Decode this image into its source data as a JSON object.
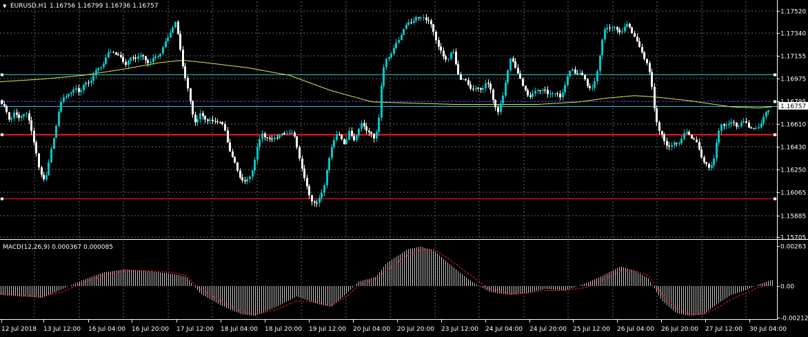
{
  "header": {
    "arrow": "▼",
    "symbol": "EURUSD,H1",
    "ohlc": "1.16756 1.16799 1.16736 1.16757"
  },
  "macd": {
    "title": "MACD(12,26,9) 0.000367 0.000085",
    "axis_labels": [
      "0.00263",
      "0.00",
      "-0.002127"
    ]
  },
  "colors": {
    "background": "#000000",
    "bull": "#00c8c8",
    "bear": "#ffffff",
    "ma": "#e8e84a",
    "red_line": "#ff1a1a",
    "blue_dashed": "#2828ff",
    "teal_line": "#28c8c8",
    "macd_signal": "#ff2020",
    "grid": "#6a6a6a"
  },
  "chart_data": [
    {
      "type": "candlestick",
      "symbol": "EURUSD,H1",
      "y_ticks": [
        "1.17520",
        "1.17340",
        "1.17155",
        "1.16975",
        "1.16795",
        "1.16610",
        "1.16430",
        "1.16250",
        "1.16065",
        "1.15885",
        "1.15705"
      ],
      "ylim": [
        1.15705,
        1.1762
      ],
      "x_ticks": [
        "12 Jul 2018",
        "13 Jul 12:00",
        "16 Jul 04:00",
        "16 Jul 20:00",
        "17 Jul 12:00",
        "18 Jul 04:00",
        "18 Jul 20:00",
        "19 Jul 12:00",
        "20 Jul 04:00",
        "20 Jul 20:00",
        "23 Jul 12:00",
        "24 Jul 04:00",
        "24 Jul 20:00",
        "25 Jul 12:00",
        "26 Jul 04:00",
        "26 Jul 20:00",
        "27 Jul 12:00",
        "30 Jul 04:00"
      ],
      "current_price": "1.16757",
      "horizontal_levels": [
        {
          "kind": "teal-solid",
          "price": 1.1701
        },
        {
          "kind": "blue-dashed",
          "price": 1.16795
        },
        {
          "kind": "teal-thin",
          "price": 1.16757
        },
        {
          "kind": "red-solid",
          "price": 1.1653
        },
        {
          "kind": "red-solid",
          "price": 1.1602
        }
      ],
      "close_path": [
        [
          0,
          1.1678
        ],
        [
          8,
          1.1672
        ],
        [
          14,
          1.1665
        ],
        [
          20,
          1.1669
        ],
        [
          26,
          1.1666
        ],
        [
          32,
          1.167
        ],
        [
          38,
          1.1668
        ],
        [
          44,
          1.166
        ],
        [
          50,
          1.1645
        ],
        [
          56,
          1.1625
        ],
        [
          62,
          1.1618
        ],
        [
          68,
          1.1622
        ],
        [
          74,
          1.164
        ],
        [
          80,
          1.1658
        ],
        [
          86,
          1.1674
        ],
        [
          92,
          1.1682
        ],
        [
          98,
          1.1687
        ],
        [
          104,
          1.1685
        ],
        [
          110,
          1.169
        ],
        [
          116,
          1.1688
        ],
        [
          122,
          1.1692
        ],
        [
          128,
          1.1695
        ],
        [
          134,
          1.1699
        ],
        [
          140,
          1.1703
        ],
        [
          146,
          1.1708
        ],
        [
          152,
          1.1712
        ],
        [
          158,
          1.1718
        ],
        [
          164,
          1.172
        ],
        [
          170,
          1.1715
        ],
        [
          176,
          1.1713
        ],
        [
          182,
          1.171
        ],
        [
          188,
          1.1712
        ],
        [
          194,
          1.1714
        ],
        [
          200,
          1.1716
        ],
        [
          206,
          1.1714
        ],
        [
          212,
          1.1712
        ],
        [
          218,
          1.1711
        ],
        [
          224,
          1.1713
        ],
        [
          230,
          1.1717
        ],
        [
          236,
          1.1722
        ],
        [
          242,
          1.1728
        ],
        [
          248,
          1.1738
        ],
        [
          254,
          1.1742
        ],
        [
          260,
          1.1725
        ],
        [
          266,
          1.1705
        ],
        [
          272,
          1.1688
        ],
        [
          278,
          1.1672
        ],
        [
          284,
          1.1662
        ],
        [
          290,
          1.1668
        ],
        [
          296,
          1.1667
        ],
        [
          302,
          1.1664
        ],
        [
          308,
          1.1662
        ],
        [
          314,
          1.1665
        ],
        [
          320,
          1.1662
        ],
        [
          326,
          1.1655
        ],
        [
          332,
          1.1643
        ],
        [
          338,
          1.1632
        ],
        [
          344,
          1.1624
        ],
        [
          350,
          1.1618
        ],
        [
          356,
          1.1613
        ],
        [
          362,
          1.162
        ],
        [
          368,
          1.163
        ],
        [
          374,
          1.1644
        ],
        [
          380,
          1.1655
        ],
        [
          386,
          1.165
        ],
        [
          392,
          1.1647
        ],
        [
          398,
          1.1652
        ],
        [
          404,
          1.165
        ],
        [
          410,
          1.1653
        ],
        [
          416,
          1.1655
        ],
        [
          422,
          1.1653
        ],
        [
          428,
          1.165
        ],
        [
          434,
          1.1635
        ],
        [
          440,
          1.1618
        ],
        [
          446,
          1.161
        ],
        [
          452,
          1.16
        ],
        [
          458,
          1.1595
        ],
        [
          464,
          1.1605
        ],
        [
          470,
          1.1612
        ],
        [
          476,
          1.163
        ],
        [
          482,
          1.1648
        ],
        [
          488,
          1.1652
        ],
        [
          494,
          1.165
        ],
        [
          500,
          1.1646
        ],
        [
          506,
          1.1654
        ],
        [
          512,
          1.1648
        ],
        [
          518,
          1.1655
        ],
        [
          524,
          1.166
        ],
        [
          530,
          1.1658
        ],
        [
          536,
          1.1655
        ],
        [
          542,
          1.1648
        ],
        [
          548,
          1.166
        ],
        [
          554,
          1.17
        ],
        [
          560,
          1.1712
        ],
        [
          566,
          1.1718
        ],
        [
          572,
          1.1722
        ],
        [
          578,
          1.1728
        ],
        [
          584,
          1.1738
        ],
        [
          590,
          1.174
        ],
        [
          596,
          1.1743
        ],
        [
          602,
          1.1748
        ],
        [
          608,
          1.1744
        ],
        [
          614,
          1.1748
        ],
        [
          620,
          1.1745
        ],
        [
          626,
          1.1738
        ],
        [
          632,
          1.173
        ],
        [
          638,
          1.172
        ],
        [
          644,
          1.1712
        ],
        [
          650,
          1.1715
        ],
        [
          656,
          1.172
        ],
        [
          662,
          1.1705
        ],
        [
          668,
          1.1698
        ],
        [
          674,
          1.1695
        ],
        [
          680,
          1.1692
        ],
        [
          686,
          1.169
        ],
        [
          692,
          1.1688
        ],
        [
          698,
          1.169
        ],
        [
          704,
          1.1694
        ],
        [
          710,
          1.169
        ],
        [
          716,
          1.168
        ],
        [
          722,
          1.167
        ],
        [
          728,
          1.168
        ],
        [
          734,
          1.17
        ],
        [
          740,
          1.1712
        ],
        [
          746,
          1.1708
        ],
        [
          752,
          1.1702
        ],
        [
          758,
          1.169
        ],
        [
          764,
          1.1686
        ],
        [
          770,
          1.1684
        ],
        [
          776,
          1.1686
        ],
        [
          782,
          1.169
        ],
        [
          788,
          1.1689
        ],
        [
          794,
          1.1684
        ],
        [
          800,
          1.1688
        ],
        [
          806,
          1.1685
        ],
        [
          812,
          1.1682
        ],
        [
          818,
          1.1692
        ],
        [
          824,
          1.17
        ],
        [
          830,
          1.1705
        ],
        [
          836,
          1.1702
        ],
        [
          842,
          1.17
        ],
        [
          848,
          1.1698
        ],
        [
          854,
          1.169
        ],
        [
          860,
          1.1688
        ],
        [
          866,
          1.1705
        ],
        [
          872,
          1.1725
        ],
        [
          878,
          1.1738
        ],
        [
          884,
          1.174
        ],
        [
          890,
          1.1738
        ],
        [
          896,
          1.1735
        ],
        [
          902,
          1.1737
        ],
        [
          908,
          1.174
        ],
        [
          914,
          1.1738
        ],
        [
          920,
          1.1732
        ],
        [
          926,
          1.1722
        ],
        [
          932,
          1.1718
        ],
        [
          938,
          1.171
        ],
        [
          944,
          1.1695
        ],
        [
          950,
          1.167
        ],
        [
          956,
          1.1655
        ],
        [
          962,
          1.1648
        ],
        [
          968,
          1.1645
        ],
        [
          974,
          1.1643
        ],
        [
          980,
          1.1646
        ],
        [
          986,
          1.1648
        ],
        [
          992,
          1.1652
        ],
        [
          998,
          1.1655
        ],
        [
          1004,
          1.165
        ],
        [
          1010,
          1.1645
        ],
        [
          1016,
          1.1638
        ],
        [
          1022,
          1.163
        ],
        [
          1028,
          1.1625
        ],
        [
          1034,
          1.1632
        ],
        [
          1040,
          1.165
        ],
        [
          1046,
          1.166
        ],
        [
          1052,
          1.1662
        ],
        [
          1058,
          1.166
        ],
        [
          1064,
          1.1662
        ],
        [
          1070,
          1.166
        ],
        [
          1076,
          1.1661
        ],
        [
          1082,
          1.1663
        ],
        [
          1088,
          1.1658
        ],
        [
          1094,
          1.1655
        ],
        [
          1100,
          1.166
        ],
        [
          1106,
          1.1665
        ],
        [
          1112,
          1.167
        ],
        [
          1118,
          1.1676
        ]
      ],
      "ma_path": [
        [
          0,
          1.1695
        ],
        [
          60,
          1.1697
        ],
        [
          120,
          1.17
        ],
        [
          180,
          1.1705
        ],
        [
          230,
          1.171
        ],
        [
          265,
          1.1712
        ],
        [
          300,
          1.171
        ],
        [
          360,
          1.1706
        ],
        [
          420,
          1.17
        ],
        [
          480,
          1.1688
        ],
        [
          540,
          1.1679
        ],
        [
          600,
          1.1678
        ],
        [
          660,
          1.1677
        ],
        [
          720,
          1.1677
        ],
        [
          780,
          1.1677
        ],
        [
          840,
          1.1679
        ],
        [
          880,
          1.1682
        ],
        [
          920,
          1.1684
        ],
        [
          950,
          1.1683
        ],
        [
          1000,
          1.168
        ],
        [
          1060,
          1.1675
        ],
        [
          1100,
          1.1674
        ],
        [
          1120,
          1.1675
        ]
      ]
    },
    {
      "type": "bar",
      "title": "MACD(12,26,9) 0.000367 0.000085",
      "ylim": [
        -0.002127,
        0.00263
      ],
      "main_path": [
        [
          0,
          -0.0006
        ],
        [
          30,
          -0.0007
        ],
        [
          60,
          -0.0008
        ],
        [
          90,
          -0.0002
        ],
        [
          120,
          0.0004
        ],
        [
          150,
          0.0009
        ],
        [
          180,
          0.0011
        ],
        [
          210,
          0.001
        ],
        [
          250,
          0.0008
        ],
        [
          270,
          0.0006
        ],
        [
          290,
          -0.0005
        ],
        [
          320,
          -0.0013
        ],
        [
          350,
          -0.0019
        ],
        [
          370,
          -0.002
        ],
        [
          400,
          -0.0014
        ],
        [
          430,
          -0.0007
        ],
        [
          460,
          -0.0012
        ],
        [
          480,
          -0.0014
        ],
        [
          500,
          -0.0006
        ],
        [
          520,
          0.0003
        ],
        [
          545,
          0.0006
        ],
        [
          560,
          0.0015
        ],
        [
          590,
          0.0024
        ],
        [
          610,
          0.0026
        ],
        [
          630,
          0.0023
        ],
        [
          650,
          0.0015
        ],
        [
          680,
          0.0004
        ],
        [
          710,
          -0.0004
        ],
        [
          740,
          -0.0006
        ],
        [
          760,
          -0.0005
        ],
        [
          790,
          -0.0002
        ],
        [
          820,
          -0.0003
        ],
        [
          850,
          0.0002
        ],
        [
          870,
          0.0006
        ],
        [
          900,
          0.0013
        ],
        [
          920,
          0.001
        ],
        [
          940,
          0.0005
        ],
        [
          960,
          -0.001
        ],
        [
          980,
          -0.0018
        ],
        [
          1000,
          -0.002
        ],
        [
          1020,
          -0.0019
        ],
        [
          1040,
          -0.0012
        ],
        [
          1060,
          -0.0006
        ],
        [
          1080,
          -0.0003
        ],
        [
          1100,
          0.0001
        ],
        [
          1118,
          0.0004
        ]
      ],
      "signal_path": [
        [
          0,
          -0.0005
        ],
        [
          30,
          -0.0006
        ],
        [
          60,
          -0.0007
        ],
        [
          90,
          -0.0004
        ],
        [
          120,
          0.0002
        ],
        [
          150,
          0.0007
        ],
        [
          180,
          0.001
        ],
        [
          210,
          0.001
        ],
        [
          250,
          0.0009
        ],
        [
          270,
          0.0007
        ],
        [
          290,
          -0.0002
        ],
        [
          320,
          -0.001
        ],
        [
          350,
          -0.0017
        ],
        [
          370,
          -0.0019
        ],
        [
          400,
          -0.0016
        ],
        [
          430,
          -0.001
        ],
        [
          460,
          -0.0011
        ],
        [
          480,
          -0.0013
        ],
        [
          500,
          -0.0008
        ],
        [
          520,
          0.0
        ],
        [
          545,
          0.0005
        ],
        [
          560,
          0.001
        ],
        [
          590,
          0.002
        ],
        [
          610,
          0.0024
        ],
        [
          630,
          0.0024
        ],
        [
          650,
          0.0018
        ],
        [
          680,
          0.0008
        ],
        [
          710,
          -0.0002
        ],
        [
          740,
          -0.0005
        ],
        [
          760,
          -0.0005
        ],
        [
          790,
          -0.0003
        ],
        [
          820,
          -0.0003
        ],
        [
          850,
          -0.0001
        ],
        [
          870,
          0.0003
        ],
        [
          900,
          0.001
        ],
        [
          920,
          0.001
        ],
        [
          940,
          0.0007
        ],
        [
          960,
          -0.0005
        ],
        [
          980,
          -0.0015
        ],
        [
          1000,
          -0.0019
        ],
        [
          1020,
          -0.0019
        ],
        [
          1040,
          -0.0015
        ],
        [
          1060,
          -0.0009
        ],
        [
          1080,
          -0.0005
        ],
        [
          1100,
          -0.0001
        ],
        [
          1118,
          0.0001
        ]
      ]
    }
  ]
}
